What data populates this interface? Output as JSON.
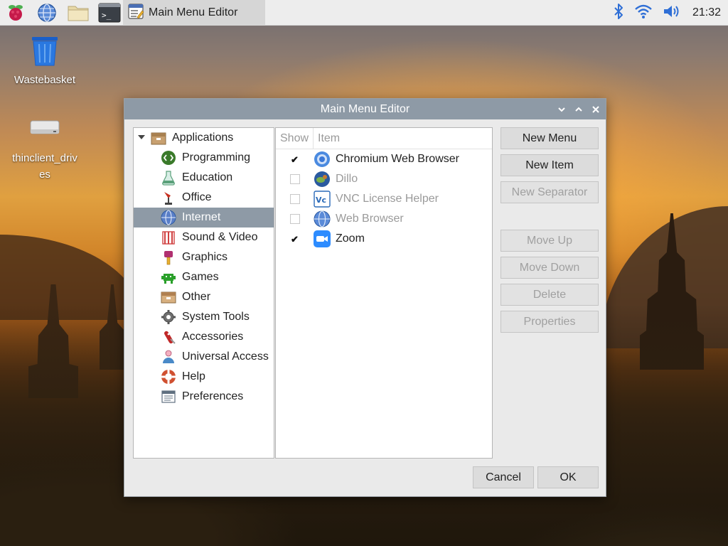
{
  "taskbar": {
    "launchers": [
      {
        "name": "raspberry-menu-icon"
      },
      {
        "name": "web-browser-icon"
      },
      {
        "name": "file-manager-icon"
      },
      {
        "name": "terminal-icon"
      }
    ],
    "active_task": {
      "icon": "menu-editor-icon",
      "label": "Main Menu Editor"
    },
    "tray": {
      "bluetooth": "bluetooth-icon",
      "wifi": "wifi-icon",
      "volume": "volume-icon"
    },
    "clock": "21:32"
  },
  "desktop": {
    "icons": [
      {
        "label": "Wastebasket",
        "icon": "trash-icon"
      },
      {
        "label": "thinclient_drives",
        "icon": "drive-icon"
      }
    ]
  },
  "window": {
    "title": "Main Menu Editor",
    "controls": [
      "minimize",
      "maximize",
      "close"
    ],
    "tree": {
      "root": "Applications",
      "items": [
        {
          "label": "Programming",
          "icon": "programming-icon",
          "color": "#3a7a2a"
        },
        {
          "label": "Education",
          "icon": "education-icon",
          "color": "#5aa07a"
        },
        {
          "label": "Office",
          "icon": "office-icon",
          "color": "#c83020"
        },
        {
          "label": "Internet",
          "icon": "internet-icon",
          "color": "#5a7fc8",
          "selected": true
        },
        {
          "label": "Sound & Video",
          "icon": "sound-video-icon",
          "color": "#d04040"
        },
        {
          "label": "Graphics",
          "icon": "graphics-icon",
          "color": "#b03070"
        },
        {
          "label": "Games",
          "icon": "games-icon",
          "color": "#2aa02a"
        },
        {
          "label": "Other",
          "icon": "other-icon",
          "color": "#b08050"
        },
        {
          "label": "System Tools",
          "icon": "system-tools-icon",
          "color": "#707070"
        },
        {
          "label": "Accessories",
          "icon": "accessories-icon",
          "color": "#c02828"
        },
        {
          "label": "Universal Access",
          "icon": "universal-access-icon",
          "color": "#4a8ac8"
        },
        {
          "label": "Help",
          "icon": "help-icon",
          "color": "#d05030"
        },
        {
          "label": "Preferences",
          "icon": "preferences-icon",
          "color": "#607080"
        }
      ]
    },
    "list": {
      "headers": {
        "show": "Show",
        "item": "Item"
      },
      "rows": [
        {
          "label": "Chromium Web Browser",
          "checked": true,
          "icon": "chromium-icon"
        },
        {
          "label": "Dillo",
          "checked": false,
          "icon": "dillo-icon"
        },
        {
          "label": "VNC License Helper",
          "checked": false,
          "icon": "vnc-icon"
        },
        {
          "label": "Web Browser",
          "checked": false,
          "icon": "web-browser-icon"
        },
        {
          "label": "Zoom",
          "checked": true,
          "icon": "zoom-icon"
        }
      ]
    },
    "buttons": {
      "new_menu": "New Menu",
      "new_item": "New Item",
      "new_separator": "New Separator",
      "move_up": "Move Up",
      "move_down": "Move Down",
      "delete": "Delete",
      "properties": "Properties",
      "cancel": "Cancel",
      "ok": "OK"
    },
    "check_mark": "✔"
  }
}
